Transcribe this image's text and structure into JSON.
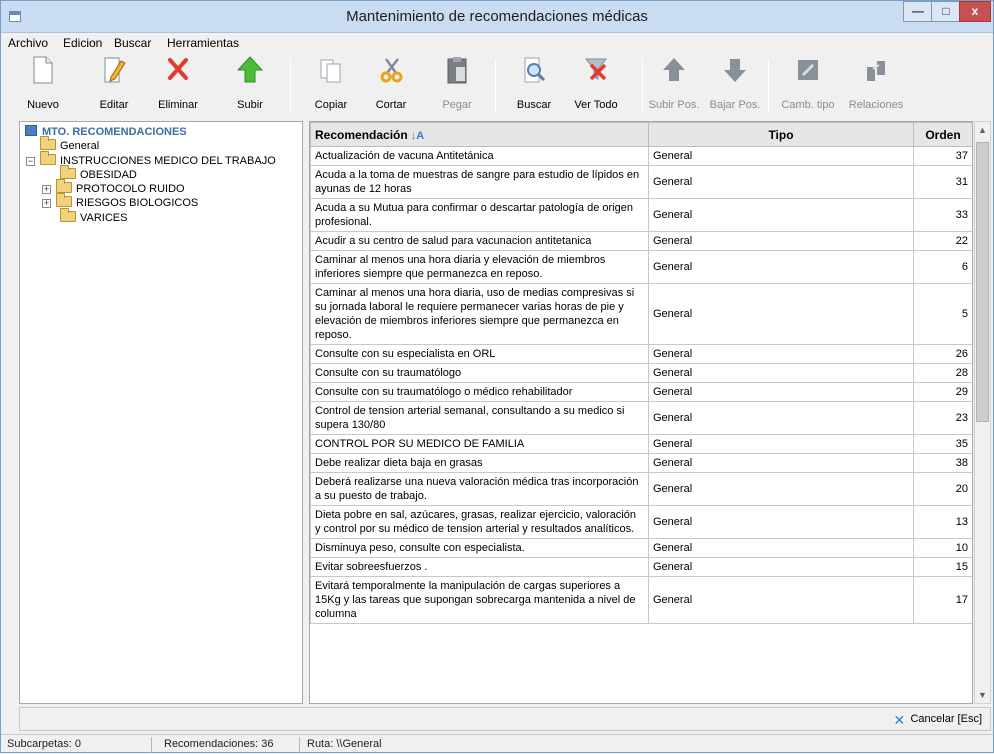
{
  "window": {
    "title": "Mantenimiento de recomendaciones médicas"
  },
  "menu": [
    "Archivo",
    "Edicion",
    "Buscar",
    "Herramientas"
  ],
  "toolbar": {
    "nuevo": "Nuevo",
    "editar": "Editar",
    "eliminar": "Eliminar",
    "subir": "Subir",
    "copiar": "Copiar",
    "cortar": "Cortar",
    "pegar": "Pegar",
    "buscar": "Buscar",
    "ver_todo": "Ver Todo",
    "subir_pos": "Subir Pos.",
    "bajar_pos": "Bajar Pos.",
    "camb_tipo": "Camb. tipo",
    "relaciones": "Relaciones"
  },
  "tree": {
    "root": "MTO. RECOMENDACIONES",
    "general": "General",
    "instrucciones": "INSTRUCCIONES MEDICO DEL TRABAJO",
    "obesidad": "OBESIDAD",
    "protocolo": "PROTOCOLO RUIDO",
    "riesgos": "RIESGOS BIOLOGICOS",
    "varices": "VARICES"
  },
  "grid": {
    "headers": {
      "rec": "Recomendación",
      "tipo": "Tipo",
      "orden": "Orden"
    },
    "rows": [
      {
        "rec": "Actualización de vacuna Antitetánica",
        "tipo": "General",
        "orden": "37"
      },
      {
        "rec": "Acuda a la toma de muestras de sangre para estudio de lípidos en ayunas de 12 horas",
        "tipo": "General",
        "orden": "31"
      },
      {
        "rec": "Acuda a su Mutua para confirmar o descartar patología de origen profesional.",
        "tipo": "General",
        "orden": "33"
      },
      {
        "rec": "Acudir a su centro de salud para vacunacion antitetanica",
        "tipo": "General",
        "orden": "22"
      },
      {
        "rec": "Caminar al menos una hora diaria y elevación de miembros inferiores siempre que permanezca en reposo.",
        "tipo": "General",
        "orden": "6"
      },
      {
        "rec": "Caminar al menos una hora diaria, uso de medias compresivas si su jornada laboral le requiere permanecer varias horas de pie y elevación de miembros inferiores siempre que permanezca en reposo.",
        "tipo": "General",
        "orden": "5"
      },
      {
        "rec": "Consulte con su especialista en ORL",
        "tipo": "General",
        "orden": "26"
      },
      {
        "rec": "Consulte con su traumatólogo",
        "tipo": "General",
        "orden": "28"
      },
      {
        "rec": "Consulte con su traumatólogo o médico rehabilitador",
        "tipo": "General",
        "orden": "29"
      },
      {
        "rec": "Control de tension arterial semanal, consultando a su medico si supera 130/80",
        "tipo": "General",
        "orden": "23"
      },
      {
        "rec": "CONTROL POR SU MEDICO DE FAMILIA",
        "tipo": "General",
        "orden": "35"
      },
      {
        "rec": "Debe realizar dieta baja en grasas",
        "tipo": "General",
        "orden": "38"
      },
      {
        "rec": "Deberá realizarse una nueva valoración médica tras incorporación a su puesto de trabajo.",
        "tipo": "General",
        "orden": "20"
      },
      {
        "rec": "Dieta pobre en sal, azúcares, grasas, realizar ejercicio, valoración y control  por su médico de tension arterial y resultados analíticos.",
        "tipo": "General",
        "orden": "13"
      },
      {
        "rec": "Disminuya peso, consulte con especialista.",
        "tipo": "General",
        "orden": "10"
      },
      {
        "rec": "Evitar sobreesfuerzos .",
        "tipo": "General",
        "orden": "15"
      },
      {
        "rec": "Evitará temporalmente la manipulación de cargas superiores a 15Kg y las tareas que supongan sobrecarga mantenida a nivel de columna",
        "tipo": "General",
        "orden": "17"
      }
    ]
  },
  "bottom": {
    "cancel": "Cancelar [Esc]"
  },
  "status": {
    "subcarpetas": "Subcarpetas: 0",
    "recomendaciones": "Recomendaciones: 36",
    "ruta": "Ruta: \\\\General"
  }
}
